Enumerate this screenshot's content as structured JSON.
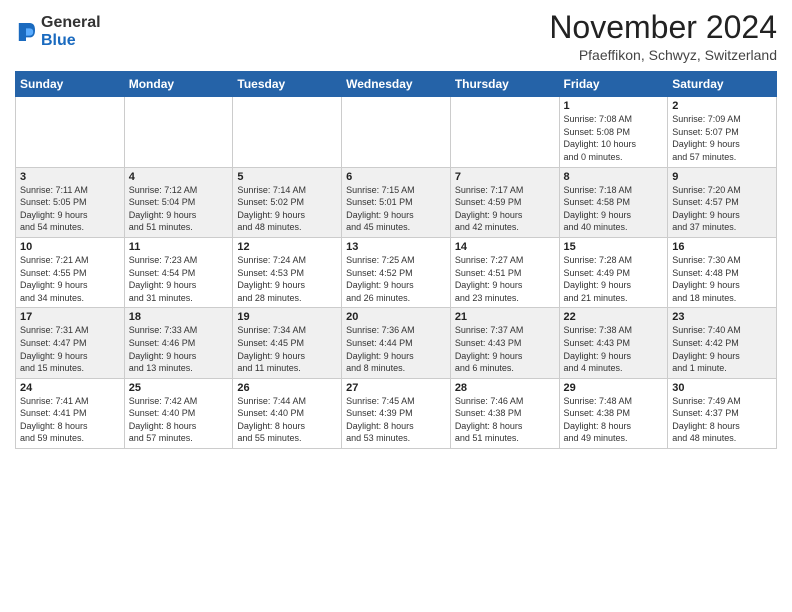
{
  "header": {
    "logo_general": "General",
    "logo_blue": "Blue",
    "month_title": "November 2024",
    "location": "Pfaeffikon, Schwyz, Switzerland"
  },
  "weekdays": [
    "Sunday",
    "Monday",
    "Tuesday",
    "Wednesday",
    "Thursday",
    "Friday",
    "Saturday"
  ],
  "weeks": [
    [
      {
        "day": "",
        "info": ""
      },
      {
        "day": "",
        "info": ""
      },
      {
        "day": "",
        "info": ""
      },
      {
        "day": "",
        "info": ""
      },
      {
        "day": "",
        "info": ""
      },
      {
        "day": "1",
        "info": "Sunrise: 7:08 AM\nSunset: 5:08 PM\nDaylight: 10 hours\nand 0 minutes."
      },
      {
        "day": "2",
        "info": "Sunrise: 7:09 AM\nSunset: 5:07 PM\nDaylight: 9 hours\nand 57 minutes."
      }
    ],
    [
      {
        "day": "3",
        "info": "Sunrise: 7:11 AM\nSunset: 5:05 PM\nDaylight: 9 hours\nand 54 minutes."
      },
      {
        "day": "4",
        "info": "Sunrise: 7:12 AM\nSunset: 5:04 PM\nDaylight: 9 hours\nand 51 minutes."
      },
      {
        "day": "5",
        "info": "Sunrise: 7:14 AM\nSunset: 5:02 PM\nDaylight: 9 hours\nand 48 minutes."
      },
      {
        "day": "6",
        "info": "Sunrise: 7:15 AM\nSunset: 5:01 PM\nDaylight: 9 hours\nand 45 minutes."
      },
      {
        "day": "7",
        "info": "Sunrise: 7:17 AM\nSunset: 4:59 PM\nDaylight: 9 hours\nand 42 minutes."
      },
      {
        "day": "8",
        "info": "Sunrise: 7:18 AM\nSunset: 4:58 PM\nDaylight: 9 hours\nand 40 minutes."
      },
      {
        "day": "9",
        "info": "Sunrise: 7:20 AM\nSunset: 4:57 PM\nDaylight: 9 hours\nand 37 minutes."
      }
    ],
    [
      {
        "day": "10",
        "info": "Sunrise: 7:21 AM\nSunset: 4:55 PM\nDaylight: 9 hours\nand 34 minutes."
      },
      {
        "day": "11",
        "info": "Sunrise: 7:23 AM\nSunset: 4:54 PM\nDaylight: 9 hours\nand 31 minutes."
      },
      {
        "day": "12",
        "info": "Sunrise: 7:24 AM\nSunset: 4:53 PM\nDaylight: 9 hours\nand 28 minutes."
      },
      {
        "day": "13",
        "info": "Sunrise: 7:25 AM\nSunset: 4:52 PM\nDaylight: 9 hours\nand 26 minutes."
      },
      {
        "day": "14",
        "info": "Sunrise: 7:27 AM\nSunset: 4:51 PM\nDaylight: 9 hours\nand 23 minutes."
      },
      {
        "day": "15",
        "info": "Sunrise: 7:28 AM\nSunset: 4:49 PM\nDaylight: 9 hours\nand 21 minutes."
      },
      {
        "day": "16",
        "info": "Sunrise: 7:30 AM\nSunset: 4:48 PM\nDaylight: 9 hours\nand 18 minutes."
      }
    ],
    [
      {
        "day": "17",
        "info": "Sunrise: 7:31 AM\nSunset: 4:47 PM\nDaylight: 9 hours\nand 15 minutes."
      },
      {
        "day": "18",
        "info": "Sunrise: 7:33 AM\nSunset: 4:46 PM\nDaylight: 9 hours\nand 13 minutes."
      },
      {
        "day": "19",
        "info": "Sunrise: 7:34 AM\nSunset: 4:45 PM\nDaylight: 9 hours\nand 11 minutes."
      },
      {
        "day": "20",
        "info": "Sunrise: 7:36 AM\nSunset: 4:44 PM\nDaylight: 9 hours\nand 8 minutes."
      },
      {
        "day": "21",
        "info": "Sunrise: 7:37 AM\nSunset: 4:43 PM\nDaylight: 9 hours\nand 6 minutes."
      },
      {
        "day": "22",
        "info": "Sunrise: 7:38 AM\nSunset: 4:43 PM\nDaylight: 9 hours\nand 4 minutes."
      },
      {
        "day": "23",
        "info": "Sunrise: 7:40 AM\nSunset: 4:42 PM\nDaylight: 9 hours\nand 1 minute."
      }
    ],
    [
      {
        "day": "24",
        "info": "Sunrise: 7:41 AM\nSunset: 4:41 PM\nDaylight: 8 hours\nand 59 minutes."
      },
      {
        "day": "25",
        "info": "Sunrise: 7:42 AM\nSunset: 4:40 PM\nDaylight: 8 hours\nand 57 minutes."
      },
      {
        "day": "26",
        "info": "Sunrise: 7:44 AM\nSunset: 4:40 PM\nDaylight: 8 hours\nand 55 minutes."
      },
      {
        "day": "27",
        "info": "Sunrise: 7:45 AM\nSunset: 4:39 PM\nDaylight: 8 hours\nand 53 minutes."
      },
      {
        "day": "28",
        "info": "Sunrise: 7:46 AM\nSunset: 4:38 PM\nDaylight: 8 hours\nand 51 minutes."
      },
      {
        "day": "29",
        "info": "Sunrise: 7:48 AM\nSunset: 4:38 PM\nDaylight: 8 hours\nand 49 minutes."
      },
      {
        "day": "30",
        "info": "Sunrise: 7:49 AM\nSunset: 4:37 PM\nDaylight: 8 hours\nand 48 minutes."
      }
    ]
  ]
}
